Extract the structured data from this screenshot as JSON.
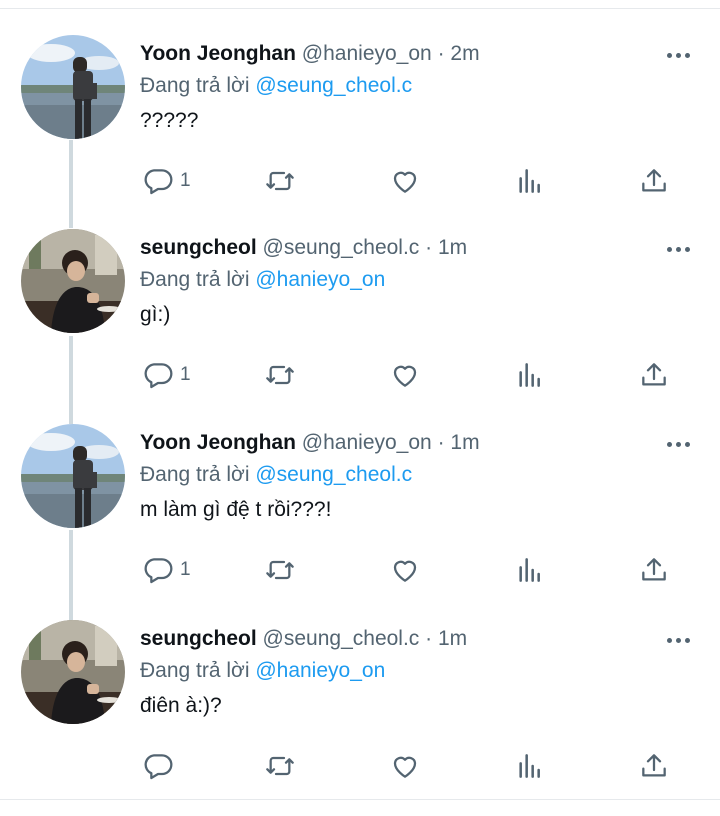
{
  "reply_prefix": "Đang trả lời",
  "colors": {
    "mention": "#1d9bf0",
    "secondary": "#536471",
    "thread_line": "#cfd9de"
  },
  "tweets": [
    {
      "author": {
        "name": "Yoon Jeonghan",
        "handle": "@hanieyo_on",
        "avatar_icon": "avatar-yoon-jeonghan"
      },
      "separator": "·",
      "time": "2m",
      "replying_to": "@seung_cheol.c",
      "text": "?????",
      "reply_count": "1"
    },
    {
      "author": {
        "name": "seungcheol",
        "handle": "@seung_cheol.c",
        "avatar_icon": "avatar-seungcheol"
      },
      "separator": "·",
      "time": "1m",
      "replying_to": "@hanieyo_on",
      "text": "gì:)",
      "reply_count": "1"
    },
    {
      "author": {
        "name": "Yoon Jeonghan",
        "handle": "@hanieyo_on",
        "avatar_icon": "avatar-yoon-jeonghan"
      },
      "separator": "·",
      "time": "1m",
      "replying_to": "@seung_cheol.c",
      "text": "m làm gì đệ t rồi???!",
      "reply_count": "1"
    },
    {
      "author": {
        "name": "seungcheol",
        "handle": "@seung_cheol.c",
        "avatar_icon": "avatar-seungcheol"
      },
      "separator": "·",
      "time": "1m",
      "replying_to": "@hanieyo_on",
      "text": "điên à:)?",
      "reply_count": ""
    }
  ],
  "action_icons": [
    "reply-icon",
    "retweet-icon",
    "like-icon",
    "views-icon",
    "share-icon"
  ]
}
